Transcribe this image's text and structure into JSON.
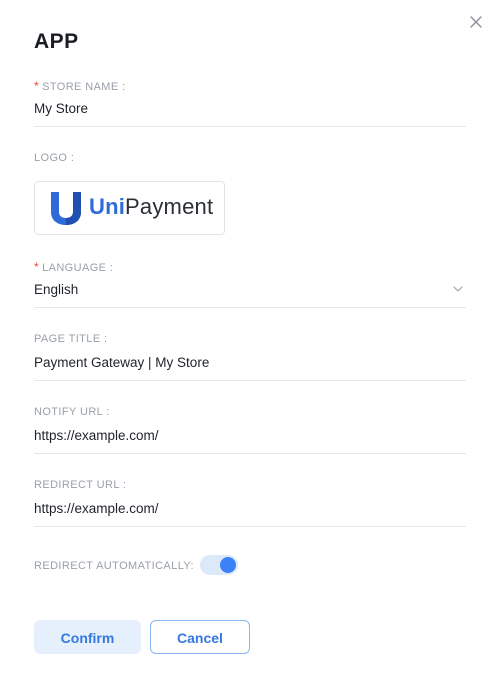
{
  "dialog": {
    "title": "APP",
    "close_icon": "close-icon"
  },
  "store_name": {
    "required_mark": "*",
    "label": "STORE NAME :",
    "value": "My Store"
  },
  "logo": {
    "label": "LOGO :",
    "brand_part1": "Uni",
    "brand_part2": "Payment",
    "brand_color": "#2f6bd8"
  },
  "language": {
    "required_mark": "*",
    "label": "LANGUAGE :",
    "value": "English",
    "icon": "chevron-down-icon"
  },
  "page_title": {
    "label": "PAGE TITLE :",
    "value": "Payment Gateway | My Store"
  },
  "notify_url": {
    "label": "NOTIFY URL :",
    "value": "https://example.com/"
  },
  "redirect_url": {
    "label": "REDIRECT URL :",
    "value": "https://example.com/"
  },
  "redirect_auto": {
    "label": "REDIRECT AUTOMATICALLY:",
    "enabled": true,
    "accent": "#3b82f6"
  },
  "actions": {
    "confirm_label": "Confirm",
    "cancel_label": "Cancel"
  }
}
